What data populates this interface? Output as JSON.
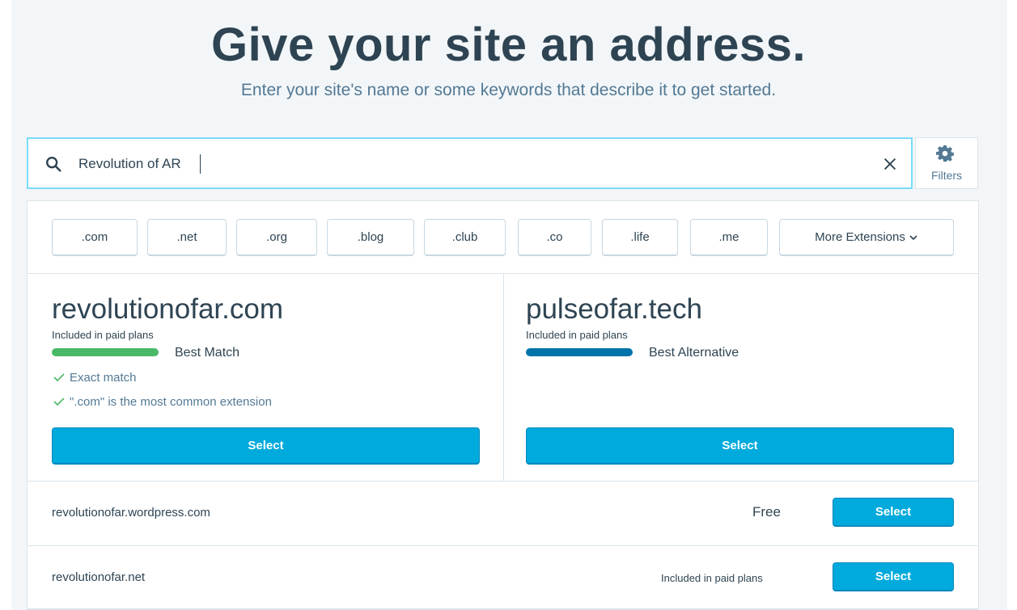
{
  "header": {
    "title": "Give your site an address.",
    "subtitle": "Enter your site's name or some keywords that describe it to get started."
  },
  "search": {
    "value": "Revolution of AR",
    "icon": "search-icon",
    "clear_icon": "close-icon"
  },
  "filters": {
    "label": "Filters",
    "icon": "gear-icon"
  },
  "extensions": {
    "items": [
      ".com",
      ".net",
      ".org",
      ".blog",
      ".club",
      ".co",
      ".life",
      ".me"
    ],
    "more_label": "More Extensions"
  },
  "featured": [
    {
      "domain": "revolutionofar.com",
      "plan_note": "Included in paid plans",
      "match_label": "Best Match",
      "bar_color": "#4ab866",
      "reasons": [
        "Exact match",
        "\".com\" is the most common extension"
      ],
      "select_label": "Select"
    },
    {
      "domain": "pulseofar.tech",
      "plan_note": "Included in paid plans",
      "match_label": "Best Alternative",
      "bar_color": "#0073aa",
      "reasons": [],
      "select_label": "Select"
    }
  ],
  "rows": [
    {
      "domain": "revolutionofar.wordpress.com",
      "price": "Free",
      "select_label": "Select"
    },
    {
      "domain": "revolutionofar.net",
      "price": "Included in paid plans",
      "select_label": "Select"
    }
  ],
  "colors": {
    "accent": "#00aadc",
    "focus_border": "#78dcfa",
    "success": "#4ab866"
  }
}
